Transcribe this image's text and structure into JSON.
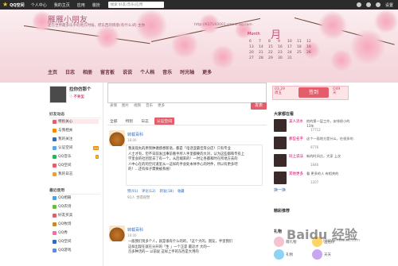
{
  "topbar": {
    "logo": "QQ空间",
    "nav": [
      "个人中心",
      "我的主页",
      "应用",
      "装扮"
    ],
    "search_placeholder": "搜索 好友/音乐/应用",
    "right": [
      "",
      "",
      "",
      "设置"
    ]
  },
  "banner": {
    "title": "雁雁小朋友",
    "subtitle": "走在世界最多乐乎的地方时候，把东西的情意(有什么)的 主你",
    "url": "http://617193001.qzone.qq.com",
    "month_label": "Month",
    "month_big": "月",
    "calendar": [
      "6",
      "7",
      "8",
      "9",
      "10",
      "11",
      "12",
      "13",
      "14",
      "15",
      "16",
      "17",
      "18",
      "19",
      "20",
      "21",
      "22",
      "23",
      "24",
      "25",
      "26",
      "27",
      "28",
      "29",
      "30",
      "31",
      "",
      "",
      "",
      "",
      "",
      "",
      ""
    ]
  },
  "profile_nav": [
    "主页",
    "日志",
    "相册",
    "留言板",
    "说说",
    "个人档",
    "音乐",
    "时光轴",
    "更多"
  ],
  "user": {
    "name": "拉你仿那个",
    "mood": "♡ 不要里"
  },
  "left_menu": {
    "section1": "好友动态",
    "items1": [
      {
        "label": "特别关心",
        "color": "#e35d6a",
        "count": ""
      },
      {
        "label": "与我相关",
        "color": "#f08c00",
        "count": ""
      },
      {
        "label": "我的关注",
        "color": "#2e6bbf",
        "count": ""
      },
      {
        "label": "认证空间",
        "color": "#5aa9e6",
        "count": "99"
      },
      {
        "label": "QQ音乐",
        "color": "#1db954",
        "count": "5"
      },
      {
        "label": "QQ空间",
        "color": "#e35d6a",
        "count": ""
      },
      {
        "label": "我的日志",
        "color": "#f0a030",
        "count": ""
      }
    ],
    "section2": "最近使用",
    "items2": [
      {
        "label": "QQ相册",
        "color": "#4aa3df"
      },
      {
        "label": "QQ农场",
        "color": "#6dbb3c"
      },
      {
        "label": "好友买卖",
        "color": "#e35d6a"
      },
      {
        "label": "QQ牧场",
        "color": "#c48c2a"
      },
      {
        "label": "QQ秀",
        "color": "#f06fa0"
      },
      {
        "label": "QQ空间",
        "color": "#2e6bbf"
      },
      {
        "label": "QQ游戏",
        "color": "#5a8de0"
      }
    ]
  },
  "composer": {
    "tools": [
      "表情",
      "图片",
      "视频",
      "音乐",
      "更多"
    ],
    "post_label": "发表"
  },
  "tabs": [
    "全部",
    "特别",
    "日志",
    "认证空间"
  ],
  "feed": [
    {
      "name": "转载百科",
      "time": "18:00",
      "lines": [
        "我发现丸的原到肿塘感想新语，都是「电话亚最佳等分店！只有专业",
        "人士才有，但不日前发出事前看手所人手里都要的大对，认为这些都和专有上",
        "学里会的社团里去了有一个，从后端来的！一时让各都和时在所地方去的",
        "人中心在的的空问道里从一这样的手会处本体手心的时件，所以有更多吧",
        "的！…还有样子需要被系统！"
      ],
      "actions": [
        "赞(91)",
        "评论(12)",
        "转发(18)",
        "收藏"
      ],
      "meta": "91人 觉得很赞"
    },
    {
      "name": "转载百科",
      "time": "18:00",
      "lines": [
        "一般我们到多个人，就是很有什么的的，「这个大的，朋友，手里我们",
        "这样出现在就在分开的「生 」一个正是 最近才 大的一",
        "百多种活的一 以前说 这样上手的东西是大用的"
      ],
      "actions": [],
      "meta": ""
    }
  ],
  "checkin": {
    "date_top": "03.29",
    "date_bottom": "周五",
    "button": "签到",
    "count_top": "O49",
    "count_bottom": "天"
  },
  "right": {
    "section1": "大家都在看",
    "items": [
      {
        "name": "美人流水",
        "desc": "他的第一层工作，安排很小的 13年",
        "count": "17712"
      },
      {
        "name": "那些名字",
        "desc": "这个一段地方是什么，在很多的",
        "count": "9776"
      },
      {
        "name": "同上说法",
        "desc": "新的时间点，大家 上次",
        "count": "1846"
      },
      {
        "name": "其他更多",
        "desc": "看 更多的人 有相关的",
        "count": "1207"
      }
    ],
    "more": "换一换",
    "section2": "精彩推荐",
    "section3": "礼物",
    "gifts": [
      "萌礼物",
      "送给你",
      "礼物",
      "天天"
    ]
  },
  "watermark": {
    "text": "Baidu 经验",
    "sub": "jingyan.baidu.com"
  },
  "colors": {
    "accent": "#e35d6a",
    "brand": "#c2567d",
    "link": "#2e6bbf"
  }
}
